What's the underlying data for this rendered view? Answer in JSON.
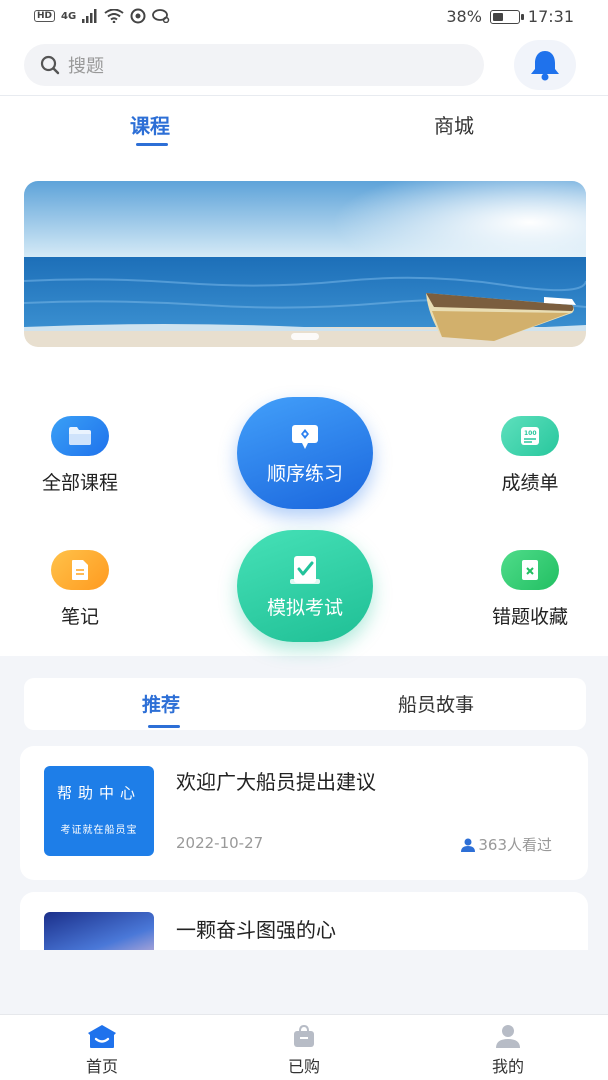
{
  "status_bar": {
    "left": [
      "HD",
      "4G",
      "signal",
      "wifi",
      "app",
      "chat"
    ],
    "network": "4G",
    "battery_percent": "38%",
    "battery_level": 0.38,
    "time": "17:31"
  },
  "search": {
    "placeholder": "搜题"
  },
  "top_tabs": [
    {
      "label": "课程",
      "active": true
    },
    {
      "label": "商城",
      "active": false
    }
  ],
  "features": {
    "all_courses": "全部课程",
    "sequential_practice": "顺序练习",
    "score_sheet": "成绩单",
    "notes": "笔记",
    "mock_exam": "模拟考试",
    "mistakes_favorites": "错题收藏"
  },
  "rec_tabs": [
    {
      "label": "推荐",
      "active": true
    },
    {
      "label": "船员故事",
      "active": false
    }
  ],
  "articles": [
    {
      "title": "欢迎广大船员提出建议",
      "date": "2022-10-27",
      "views": "363人看过",
      "thumb_title": "帮助中心",
      "thumb_sub": "考证就在船员宝"
    },
    {
      "title": "一颗奋斗图强的心"
    }
  ],
  "bottom_nav": [
    {
      "label": "首页",
      "icon": "home-icon",
      "active": true
    },
    {
      "label": "已购",
      "icon": "bag-icon",
      "active": false
    },
    {
      "label": "我的",
      "icon": "user-icon",
      "active": false
    }
  ],
  "colors": {
    "accent": "#2d6fd6",
    "bg": "#f3f5f9",
    "practice_gradient": [
      "#3b8cf5",
      "#1f6fe0"
    ],
    "exam_gradient": [
      "#3ddbb0",
      "#22c29a"
    ]
  }
}
